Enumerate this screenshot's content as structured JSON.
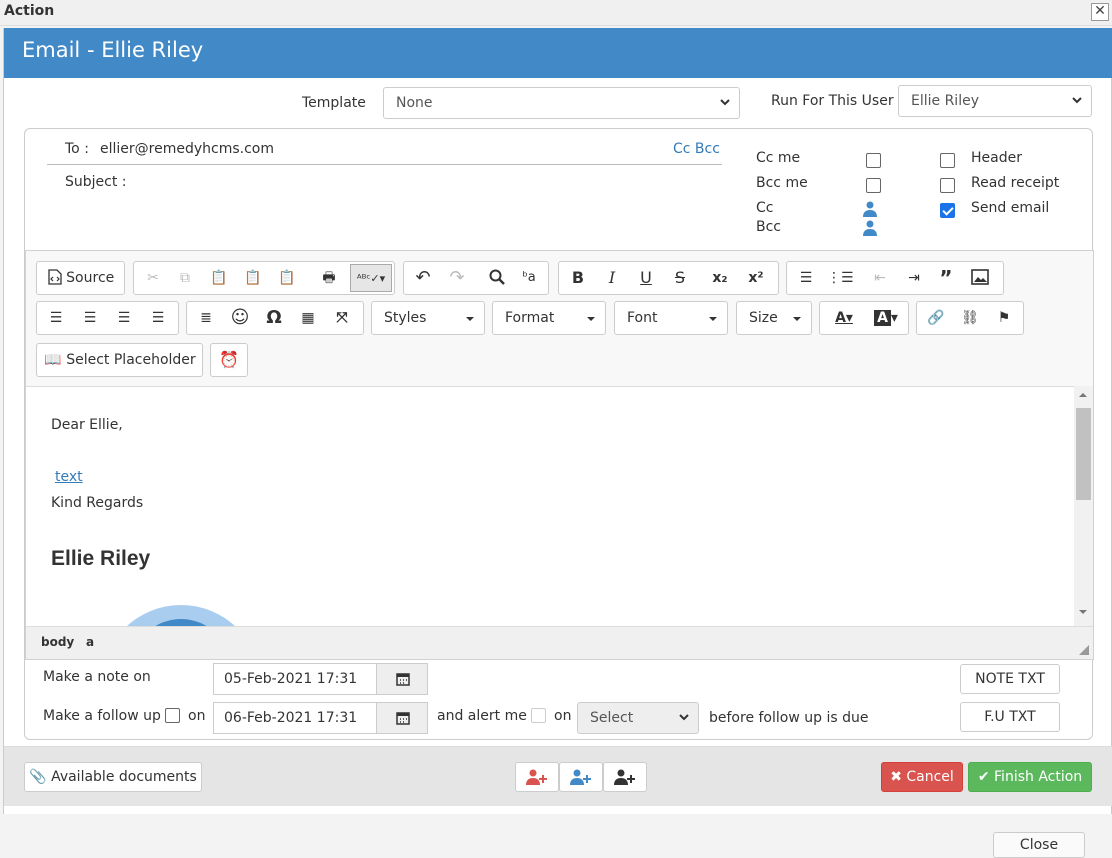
{
  "window": {
    "title": "Action",
    "close_glyph": "✕"
  },
  "header": {
    "title": "Email - Ellie Riley"
  },
  "top": {
    "template_label": "Template",
    "template_value": "None",
    "run_for_label": "Run For This User",
    "run_for_value": "Ellie Riley"
  },
  "mail": {
    "to_label": "To :",
    "to_value": "ellier@remedyhcms.com",
    "cc_bcc_link": "Cc Bcc",
    "subject_label": "Subject :",
    "subject_value": ""
  },
  "options": {
    "cc_me": "Cc me",
    "bcc_me": "Bcc me",
    "cc": "Cc",
    "bcc": "Bcc",
    "header": "Header",
    "read_receipt": "Read receipt",
    "send_email": "Send email",
    "send_email_checked": true
  },
  "toolbar": {
    "source": "Source",
    "styles": "Styles",
    "format": "Format",
    "font": "Font",
    "size": "Size",
    "select_placeholder": "Select Placeholder"
  },
  "body": {
    "greeting": "Dear Ellie,",
    "link": "text",
    "closing": "Kind Regards",
    "signature_name": "Ellie Riley"
  },
  "statusbar": {
    "path1": "body",
    "path2": "a"
  },
  "followup": {
    "note_label": "Make a note on",
    "note_date": "05-Feb-2021 17:31",
    "note_btn": "NOTE TXT",
    "followup_label": "Make a follow up",
    "on1": "on",
    "followup_date": "06-Feb-2021 17:31",
    "alert_label": "and alert me",
    "on2": "on",
    "alert_select": "Select",
    "before_label": "before follow up is due",
    "fu_btn": "F.U TXT"
  },
  "footer": {
    "available_docs": "Available documents",
    "cancel": "Cancel",
    "finish": "Finish Action",
    "close": "Close"
  },
  "colors": {
    "header": "#4189c7",
    "cancel": "#d9534f",
    "finish": "#5cb85c",
    "link": "#337ab7"
  }
}
